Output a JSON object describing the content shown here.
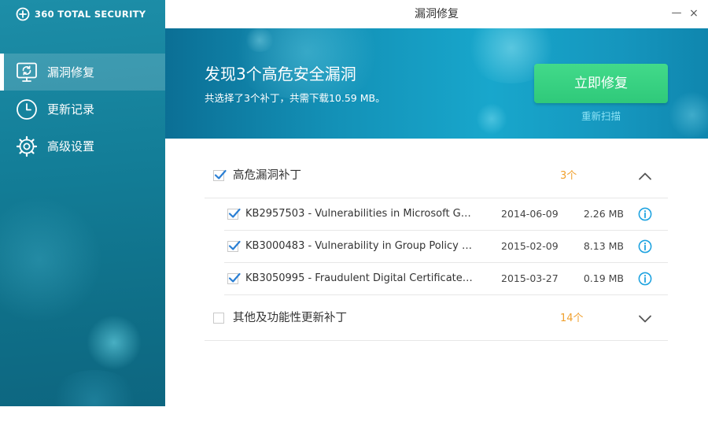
{
  "app": {
    "brand": "360 TOTAL SECURITY",
    "window_title": "漏洞修复"
  },
  "window_controls": {
    "minimize": "—",
    "close": "×"
  },
  "sidebar": {
    "items": [
      {
        "label": "漏洞修复",
        "icon": "monitor-repair-icon",
        "active": true
      },
      {
        "label": "更新记录",
        "icon": "clock-icon",
        "active": false
      },
      {
        "label": "高级设置",
        "icon": "gear-icon",
        "active": false
      }
    ]
  },
  "banner": {
    "headline": "发现3个高危安全漏洞",
    "summary": "共选择了3个补丁，共需下载10.59 MB。",
    "repair_button": "立即修复",
    "rescan_link": "重新扫描"
  },
  "groups": {
    "high_risk": {
      "label": "高危漏洞补丁",
      "count": "3个",
      "checked": true,
      "expanded": true,
      "patches": [
        {
          "name": "KB2957503 - Vulnerabilities in Microsoft Gra...",
          "date": "2014-06-09",
          "size": "2.26 MB",
          "checked": true
        },
        {
          "name": "KB3000483 - Vulnerability in Group Policy Co...",
          "date": "2015-02-09",
          "size": "8.13 MB",
          "checked": true
        },
        {
          "name": "KB3050995 - Fraudulent Digital Certificates C...",
          "date": "2015-03-27",
          "size": "0.19 MB",
          "checked": true
        }
      ]
    },
    "other": {
      "label": "其他及功能性更新补丁",
      "count": "14个",
      "checked": false,
      "expanded": false
    }
  },
  "colors": {
    "accent_green": "#35cf7e",
    "count_orange": "#f0a02d",
    "check_blue": "#2a7fd4",
    "info_blue": "#1fa3e0",
    "sidebar_teal": "#137e98"
  }
}
